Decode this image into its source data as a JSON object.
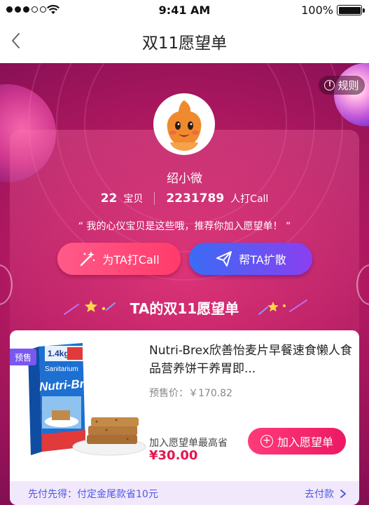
{
  "status_bar": {
    "time": "9:41 AM",
    "battery_percent": "100%",
    "signal_bars_filled": 3,
    "signal_bars_total": 5
  },
  "nav": {
    "back_icon": "chevron-left-icon",
    "title": "双11愿望单"
  },
  "hero": {
    "rules_label": "规则",
    "user_name": "绍小微",
    "stats": {
      "items_count": "22",
      "items_label": "宝贝",
      "call_count": "2231789",
      "call_label": "人打Call"
    },
    "quote": "“ 我的心仪宝贝是这些哦，推荐你加入愿望单！ ”",
    "call_button_label": "为TA打Call",
    "share_button_label": "帮TA扩散",
    "section_title": "TA的双11愿望单"
  },
  "product": {
    "badge": "预售",
    "title": "Nutri-Brex欣善怡麦片早餐速食懒人食品营养饼干养胃即...",
    "presale_price": "预售价：￥170.82",
    "save_label": "加入愿望单最高省",
    "save_amount": "¥30.00",
    "add_button_label": "加入愿望单",
    "pay_first_text": "先付先得：付定金尾款省10元",
    "pay_link_label": "去付款"
  },
  "colors": {
    "accent_pink": "#ec1964",
    "accent_purple": "#7a58f0",
    "link_blue": "#4a5ae8",
    "hero_base": "#b61a62"
  }
}
